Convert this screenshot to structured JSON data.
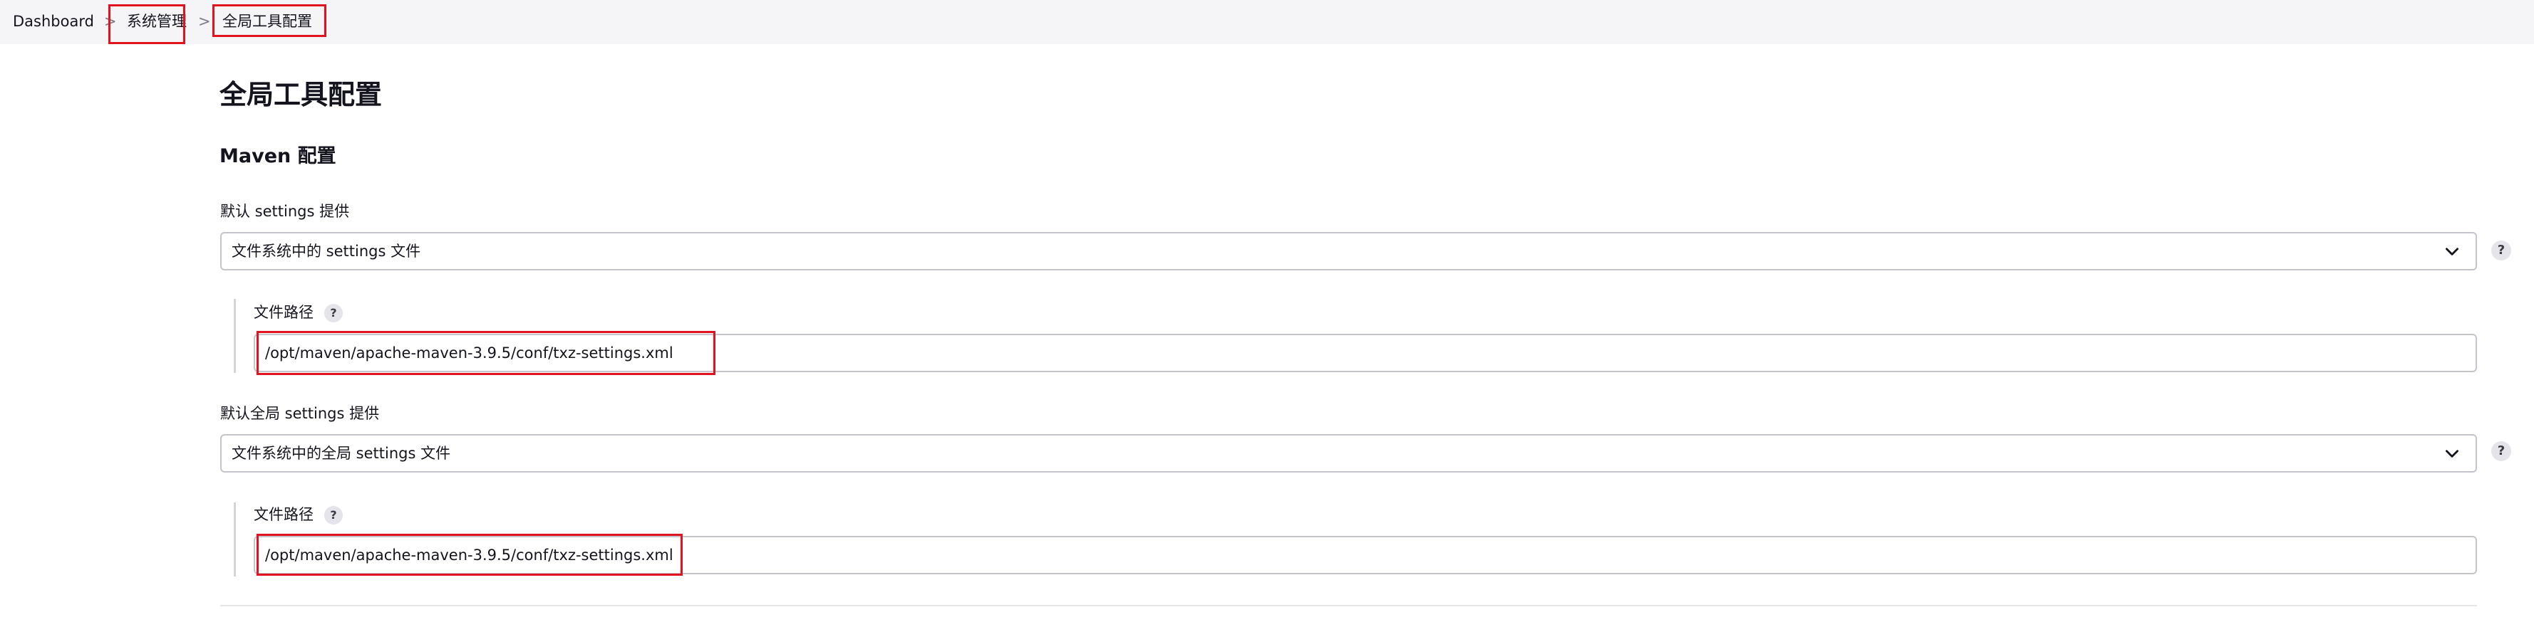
{
  "breadcrumb": {
    "items": [
      "Dashboard",
      "系统管理",
      "全局工具配置"
    ],
    "separator": ">"
  },
  "page": {
    "title": "全局工具配置",
    "section_title": "Maven 配置"
  },
  "maven": {
    "settings": {
      "label": "默认 settings 提供",
      "selected": "文件系统中的 settings 文件",
      "path_label": "文件路径",
      "path_value": "/opt/maven/apache-maven-3.9.5/conf/txz-settings.xml"
    },
    "global_settings": {
      "label": "默认全局 settings 提供",
      "selected": "文件系统中的全局 settings 文件",
      "path_label": "文件路径",
      "path_value": "/opt/maven/apache-maven-3.9.5/conf/txz-settings.xml"
    }
  },
  "help_symbol": "?",
  "icons": {
    "help": "help-icon",
    "dropdown": "chevron-down-icon"
  },
  "colors": {
    "highlight_box": "#e0141e",
    "breadcrumb_bg": "#f5f5f7"
  }
}
